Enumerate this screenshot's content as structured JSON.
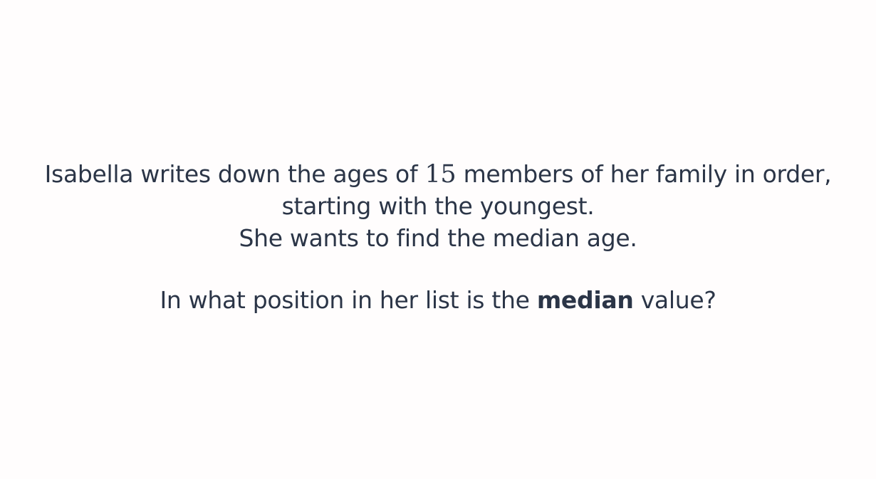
{
  "question": {
    "line1_before": "Isabella writes down the ages of ",
    "line1_number": "15",
    "line1_after": " members of her family in order,",
    "line2": "starting with the youngest.",
    "line3": "She wants to find the median age.",
    "line4_before": "In what position in her list is the ",
    "line4_bold": "median",
    "line4_after": " value?"
  }
}
